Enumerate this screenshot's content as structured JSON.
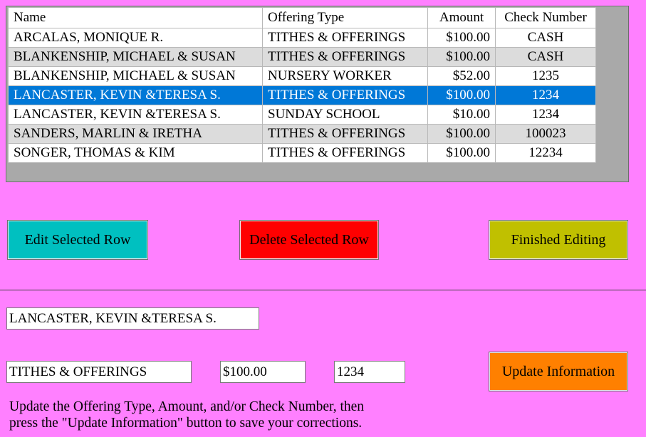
{
  "grid": {
    "columns": [
      "Name",
      "Offering Type",
      "Amount",
      "Check Number"
    ],
    "rows": [
      {
        "name": "ARCALAS, MONIQUE R.",
        "type": "TITHES & OFFERINGS",
        "amount": "$100.00",
        "check": "CASH"
      },
      {
        "name": "BLANKENSHIP, MICHAEL & SUSAN",
        "type": "TITHES & OFFERINGS",
        "amount": "$100.00",
        "check": "CASH"
      },
      {
        "name": "BLANKENSHIP, MICHAEL & SUSAN",
        "type": "NURSERY WORKER",
        "amount": "$52.00",
        "check": "1235"
      },
      {
        "name": "LANCASTER, KEVIN &TERESA S.",
        "type": "TITHES & OFFERINGS",
        "amount": "$100.00",
        "check": "1234"
      },
      {
        "name": "LANCASTER, KEVIN &TERESA S.",
        "type": "SUNDAY SCHOOL",
        "amount": "$10.00",
        "check": "1234"
      },
      {
        "name": "SANDERS, MARLIN & IRETHA",
        "type": "TITHES & OFFERINGS",
        "amount": "$100.00",
        "check": "100023"
      },
      {
        "name": "SONGER, THOMAS & KIM",
        "type": "TITHES & OFFERINGS",
        "amount": "$100.00",
        "check": "12234"
      }
    ],
    "selected_row": 3
  },
  "buttons": {
    "edit": {
      "label": "Edit Selected Row",
      "color": "#00c0c0"
    },
    "delete": {
      "label": "Delete Selected Row",
      "color": "#ff0000"
    },
    "finished": {
      "label": "Finished Editing",
      "color": "#c0c000"
    },
    "update": {
      "label": "Update Information",
      "color": "#ff8000"
    }
  },
  "form": {
    "name": "LANCASTER, KEVIN &TERESA S.",
    "offering_type": "TITHES & OFFERINGS",
    "amount": "$100.00",
    "check_number": "1234"
  },
  "help_text": {
    "line1": "Update the Offering Type, Amount, and/or Check Number, then",
    "line2": "press the \"Update Information\" button to save your corrections."
  },
  "colors": {
    "background": "#ff80ff",
    "grid_background": "#a9a9a9",
    "selection": "#0078d7"
  }
}
